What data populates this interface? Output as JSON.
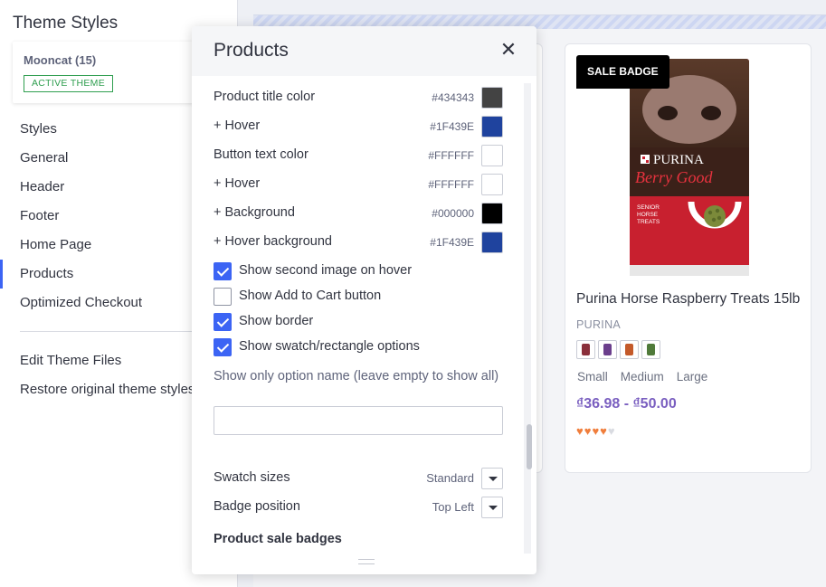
{
  "sidebar": {
    "title": "Theme Styles",
    "theme": {
      "name": "Mooncat (15)",
      "badge": "ACTIVE THEME"
    },
    "nav": [
      {
        "label": "Styles"
      },
      {
        "label": "General"
      },
      {
        "label": "Header"
      },
      {
        "label": "Footer"
      },
      {
        "label": "Home Page"
      },
      {
        "label": "Products",
        "active": true
      },
      {
        "label": "Optimized Checkout"
      }
    ],
    "nav2": [
      {
        "label": "Edit Theme Files"
      },
      {
        "label": "Restore original theme styles"
      }
    ]
  },
  "modal": {
    "title": "Products",
    "close_icon": "close-icon",
    "colors": [
      {
        "label": "Product title color",
        "hex": "#434343",
        "color": "#434343"
      },
      {
        "label": "+ Hover",
        "hex": "#1F439E",
        "color": "#1F439E"
      },
      {
        "label": "Button text color",
        "hex": "#FFFFFF",
        "color": "#FFFFFF"
      },
      {
        "label": "+ Hover",
        "hex": "#FFFFFF",
        "color": "#FFFFFF"
      },
      {
        "label": "+ Background",
        "hex": "#000000",
        "color": "#000000"
      },
      {
        "label": "+ Hover background",
        "hex": "#1F439E",
        "color": "#1F439E"
      }
    ],
    "checkboxes": [
      {
        "label": "Show second image on hover",
        "checked": true
      },
      {
        "label": "Show Add to Cart button",
        "checked": false
      },
      {
        "label": "Show border",
        "checked": true
      },
      {
        "label": "Show swatch/rectangle options",
        "checked": true
      }
    ],
    "option_name": {
      "label": "Show only option name (leave empty to show all)",
      "value": ""
    },
    "selects": [
      {
        "label": "Swatch sizes",
        "value": "Standard"
      },
      {
        "label": "Badge position",
        "value": "Top Left"
      }
    ],
    "section_title": "Product sale badges"
  },
  "preview": {
    "badge": "SALE BADGE",
    "product": {
      "title": "Purina Horse Raspberry Treats 15lb",
      "brand": "PURINA",
      "swatch_colors": [
        "#8a2f3b",
        "#6b3f8c",
        "#c45a2a",
        "#4f7a3a"
      ],
      "sizes": [
        "Small",
        "Medium",
        "Large"
      ],
      "price": "₫36.98 - ₫50.00",
      "rating": 4,
      "rating_max": 5
    },
    "bag": {
      "brand": "PURINA",
      "name": "Berry Good",
      "desc": [
        "SENIOR",
        "HORSE",
        "TREATS"
      ]
    }
  }
}
